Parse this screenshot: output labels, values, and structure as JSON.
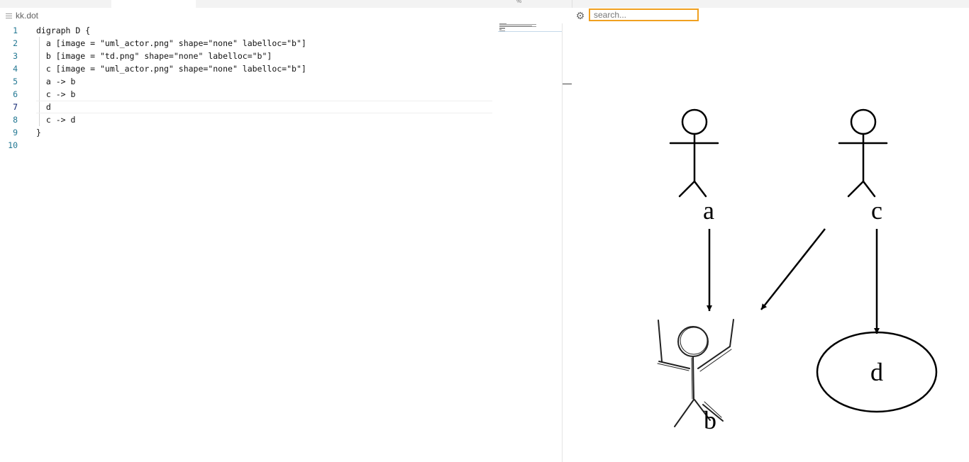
{
  "editor": {
    "breadcrumb": "kk.dot",
    "current_line": 7,
    "lines": [
      {
        "n": "1",
        "text": "digraph D {"
      },
      {
        "n": "2",
        "text": "  a [image = \"uml_actor.png\" shape=\"none\" labelloc=\"b\"]"
      },
      {
        "n": "3",
        "text": "  b [image = \"td.png\" shape=\"none\" labelloc=\"b\"]"
      },
      {
        "n": "4",
        "text": "  c [image = \"uml_actor.png\" shape=\"none\" labelloc=\"b\"]"
      },
      {
        "n": "5",
        "text": "  a -> b"
      },
      {
        "n": "6",
        "text": "  c -> b"
      },
      {
        "n": "7",
        "text": "  d"
      },
      {
        "n": "8",
        "text": "  c -> d"
      },
      {
        "n": "9",
        "text": "}"
      },
      {
        "n": "10",
        "text": ""
      }
    ]
  },
  "preview": {
    "search_placeholder": "search...",
    "search_border_color": "#f0a020",
    "settings_icon": "gear-icon",
    "graph": {
      "nodes": [
        {
          "id": "a",
          "label": "a",
          "image": "uml-actor-icon"
        },
        {
          "id": "b",
          "label": "b",
          "image": "td-sketch-figure"
        },
        {
          "id": "c",
          "label": "c",
          "image": "uml-actor-icon"
        },
        {
          "id": "d",
          "label": "d",
          "shape": "ellipse"
        }
      ],
      "edges": [
        {
          "from": "a",
          "to": "b"
        },
        {
          "from": "c",
          "to": "b"
        },
        {
          "from": "c",
          "to": "d"
        }
      ]
    }
  }
}
